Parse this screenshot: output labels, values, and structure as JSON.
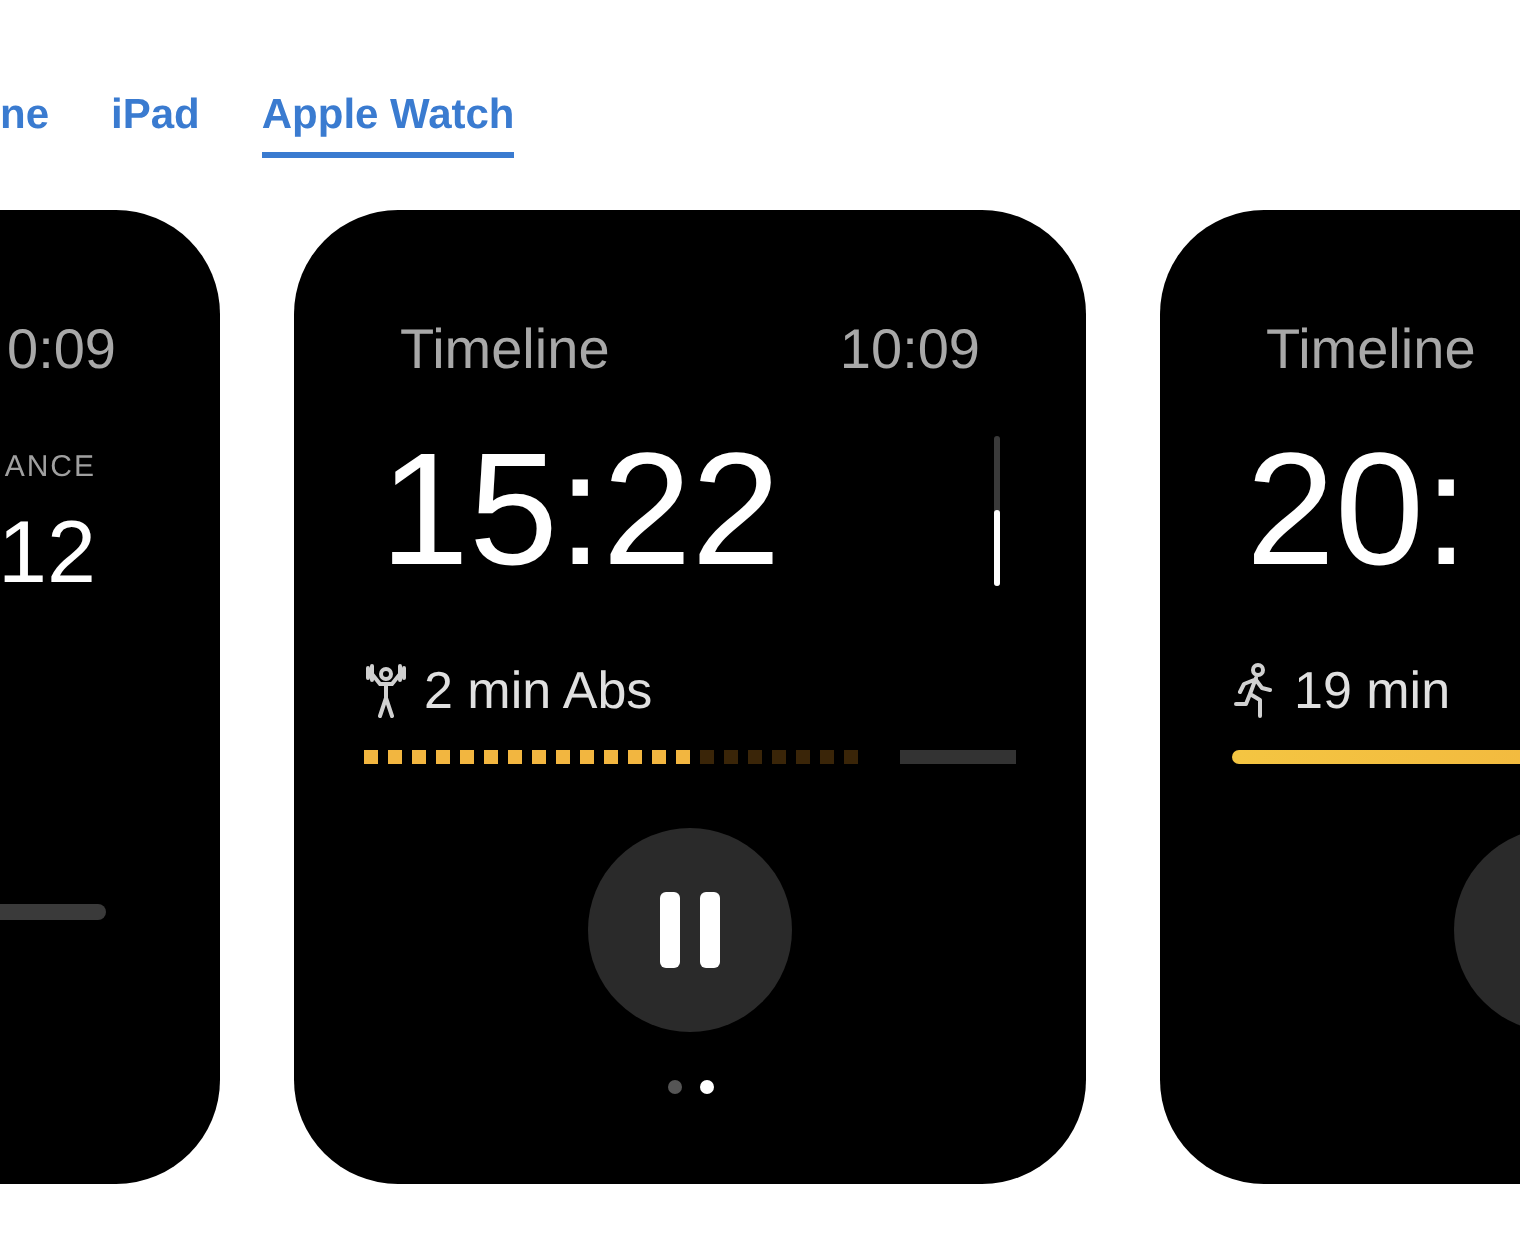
{
  "tabs": [
    {
      "label": "ne",
      "selected": false
    },
    {
      "label": "iPad",
      "selected": false
    },
    {
      "label": "Apple Watch",
      "selected": true
    }
  ],
  "screens": [
    {
      "kind": "metric",
      "clock": "0:09",
      "metric_label": "ANCE",
      "metric_value": "12"
    },
    {
      "kind": "workout",
      "title": "Timeline",
      "clock": "10:09",
      "timer": "15:22",
      "activity": {
        "kind": "strength",
        "label": "2 min Abs"
      },
      "progress": {
        "kind": "dots",
        "level": 0.67
      },
      "page_dots": [
        {
          "selected": false
        },
        {
          "selected": true
        }
      ]
    },
    {
      "kind": "workout",
      "title": "Timeline",
      "timer": "20:",
      "activity": {
        "kind": "run",
        "label": "19 min"
      },
      "progress": {
        "kind": "bar"
      }
    }
  ]
}
